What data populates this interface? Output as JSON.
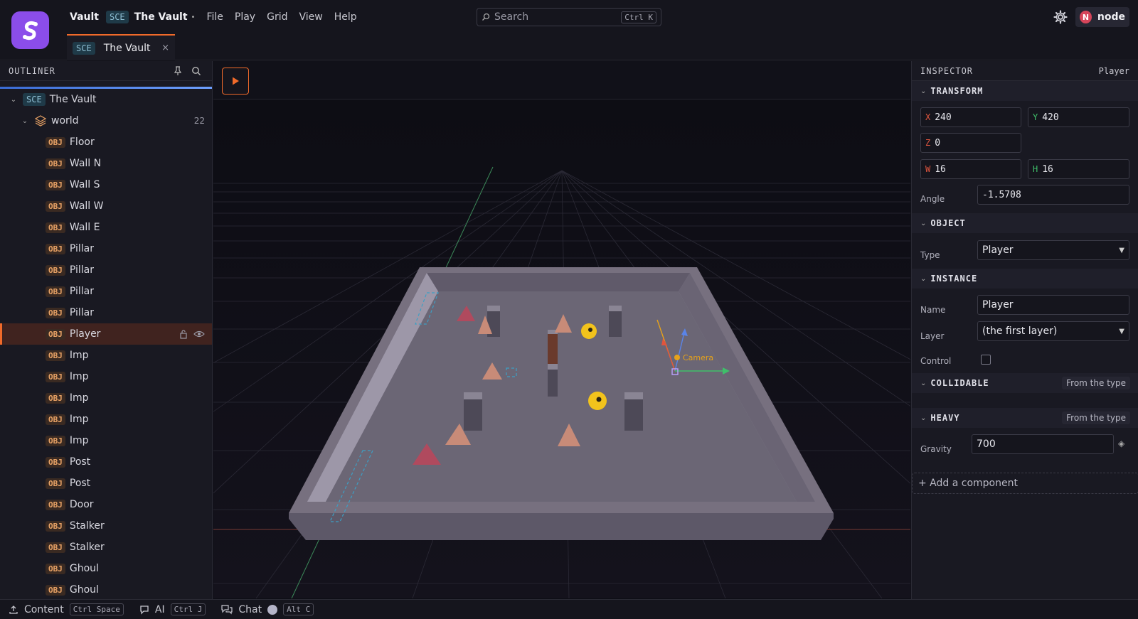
{
  "app": {
    "name": "Vault",
    "scene_tag": "SCE",
    "scene_name": "The Vault",
    "dirty_marker": "•",
    "menu": [
      "File",
      "Play",
      "Grid",
      "View",
      "Help"
    ]
  },
  "search": {
    "placeholder": "Search",
    "shortcut": "Ctrl K"
  },
  "user": {
    "initial": "N",
    "name": "node"
  },
  "doc_tab": {
    "tag": "SCE",
    "name": "The Vault",
    "close": "×"
  },
  "outliner": {
    "title": "OUTLINER",
    "root": {
      "tag": "SCE",
      "name": "The Vault"
    },
    "layer": {
      "name": "world",
      "count": "22"
    },
    "obj_tag": "OBJ",
    "items": [
      "Floor",
      "Wall N",
      "Wall S",
      "Wall W",
      "Wall E",
      "Pillar",
      "Pillar",
      "Pillar",
      "Pillar",
      "Player",
      "Imp",
      "Imp",
      "Imp",
      "Imp",
      "Imp",
      "Post",
      "Post",
      "Door",
      "Stalker",
      "Stalker",
      "Ghoul",
      "Ghoul"
    ],
    "selected_index": 9
  },
  "viewport": {
    "camera_label": "Camera"
  },
  "inspector": {
    "title": "INSPECTOR",
    "selected": "Player",
    "transform": {
      "title": "TRANSFORM",
      "x_label": "X",
      "x": "240",
      "y_label": "Y",
      "y": "420",
      "z_label": "Z",
      "z": "0",
      "w_label": "W",
      "w": "16",
      "h_label": "H",
      "h": "16",
      "angle_label": "Angle",
      "angle": "-1.5708"
    },
    "object": {
      "title": "OBJECT",
      "type_label": "Type",
      "type": "Player"
    },
    "instance": {
      "title": "INSTANCE",
      "name_label": "Name",
      "name": "Player",
      "layer_label": "Layer",
      "layer": "(the first layer)",
      "control_label": "Control",
      "control_checked": false
    },
    "collidable": {
      "title": "COLLIDABLE",
      "note": "From the type"
    },
    "heavy": {
      "title": "HEAVY",
      "note": "From the type",
      "gravity_label": "Gravity",
      "gravity": "700"
    },
    "add_component": "+ Add a component"
  },
  "statusbar": {
    "content": "Content",
    "content_key": "Ctrl Space",
    "ai": "AI",
    "ai_key": "Ctrl J",
    "chat": "Chat",
    "chat_key": "Alt C"
  },
  "colors": {
    "accent": "#f06a2a",
    "brand": "#8b4dea",
    "x_axis": "#e0553e",
    "y_axis": "#3fbf6a",
    "z_axis": "#e0553e"
  }
}
